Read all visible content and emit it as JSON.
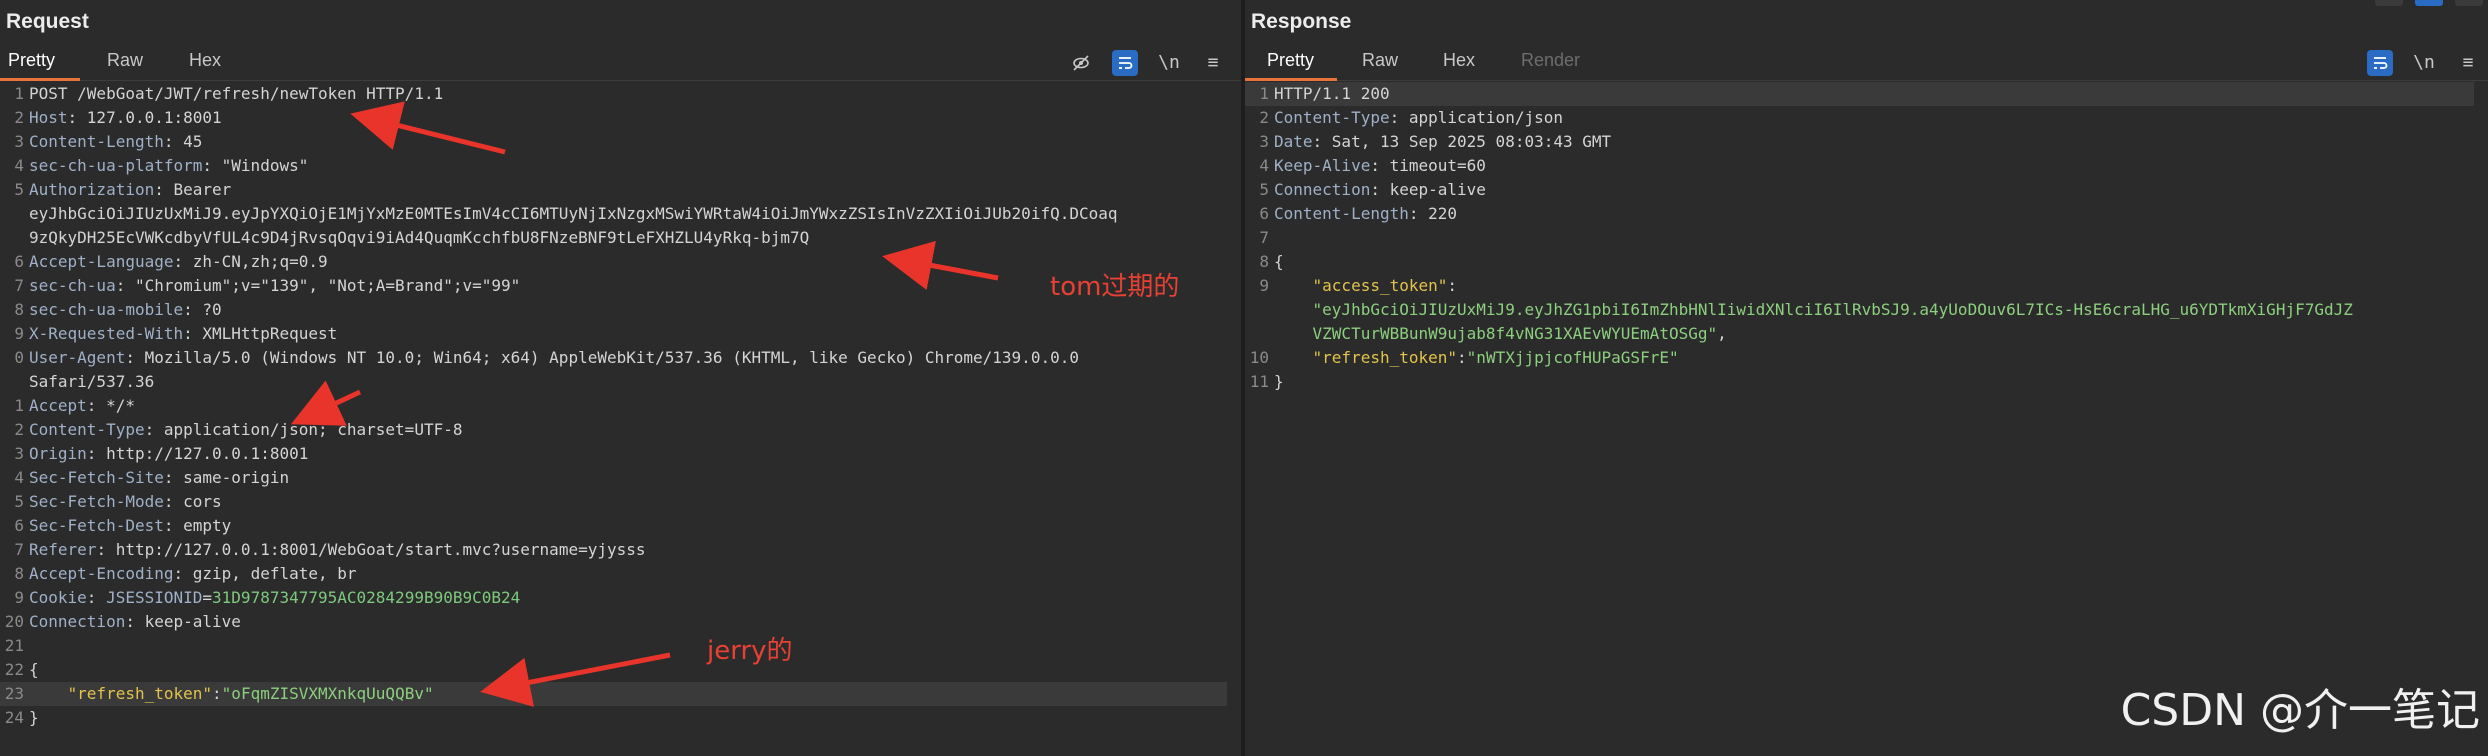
{
  "request": {
    "title": "Request",
    "tabs": [
      "Pretty",
      "Raw",
      "Hex"
    ],
    "toolbar": {
      "wrap_label": "\\n",
      "menu_label": "≡"
    },
    "lines": [
      {
        "no": "1",
        "parts": [
          {
            "t": "POST /WebGoat/JWT/refresh/newToken HTTP/1.1",
            "c": "v"
          }
        ]
      },
      {
        "no": "2",
        "parts": [
          {
            "t": "Host",
            "c": "k"
          },
          {
            "t": ": 127.0.0.1:8001",
            "c": "v"
          }
        ]
      },
      {
        "no": "3",
        "parts": [
          {
            "t": "Content-Length",
            "c": "k"
          },
          {
            "t": ": 45",
            "c": "v"
          }
        ]
      },
      {
        "no": "4",
        "parts": [
          {
            "t": "sec-ch-ua-platform",
            "c": "k"
          },
          {
            "t": ": \"Windows\"",
            "c": "v"
          }
        ]
      },
      {
        "no": "5",
        "parts": [
          {
            "t": "Authorization",
            "c": "k"
          },
          {
            "t": ": Bearer",
            "c": "v"
          }
        ]
      },
      {
        "no": "",
        "parts": [
          {
            "t": "eyJhbGciOiJIUzUxMiJ9.eyJpYXQiOjE1MjYxMzE0MTEsImV4cCI6MTUyNjIxNzgxMSwiYWRtaW4iOiJmYWxzZSIsInVzZXIiOiJUb20ifQ.DCoaq",
            "c": "v"
          }
        ]
      },
      {
        "no": "",
        "parts": [
          {
            "t": "9zQkyDH25EcVWKcdbyVfUL4c9D4jRvsqOqvi9iAd4QuqmKcchfbU8FNzeBNF9tLeFXHZLU4yRkq-bjm7Q",
            "c": "v"
          }
        ]
      },
      {
        "no": "6",
        "parts": [
          {
            "t": "Accept-Language",
            "c": "k"
          },
          {
            "t": ": zh-CN,zh;q=0.9",
            "c": "v"
          }
        ]
      },
      {
        "no": "7",
        "parts": [
          {
            "t": "sec-ch-ua",
            "c": "k"
          },
          {
            "t": ": \"Chromium\";v=\"139\", \"Not;A=Brand\";v=\"99\"",
            "c": "v"
          }
        ]
      },
      {
        "no": "8",
        "parts": [
          {
            "t": "sec-ch-ua-mobile",
            "c": "k"
          },
          {
            "t": ": ?0",
            "c": "v"
          }
        ]
      },
      {
        "no": "9",
        "parts": [
          {
            "t": "X-Requested-With",
            "c": "k"
          },
          {
            "t": ": XMLHttpRequest",
            "c": "v"
          }
        ]
      },
      {
        "no": "0",
        "parts": [
          {
            "t": "User-Agent",
            "c": "k"
          },
          {
            "t": ": Mozilla/5.0 (Windows NT 10.0; Win64; x64) AppleWebKit/537.36 (KHTML, like Gecko) Chrome/139.0.0.0",
            "c": "v"
          }
        ]
      },
      {
        "no": "",
        "parts": [
          {
            "t": "Safari/537.36",
            "c": "v"
          }
        ]
      },
      {
        "no": "1",
        "parts": [
          {
            "t": "Accept",
            "c": "k"
          },
          {
            "t": ": */*",
            "c": "v"
          }
        ]
      },
      {
        "no": "2",
        "parts": [
          {
            "t": "Content-Type",
            "c": "k"
          },
          {
            "t": ": application/json; charset=UTF-8",
            "c": "v"
          }
        ]
      },
      {
        "no": "3",
        "parts": [
          {
            "t": "Origin",
            "c": "k"
          },
          {
            "t": ": http://127.0.0.1:8001",
            "c": "v"
          }
        ]
      },
      {
        "no": "4",
        "parts": [
          {
            "t": "Sec-Fetch-Site",
            "c": "k"
          },
          {
            "t": ": same-origin",
            "c": "v"
          }
        ]
      },
      {
        "no": "5",
        "parts": [
          {
            "t": "Sec-Fetch-Mode",
            "c": "k"
          },
          {
            "t": ": cors",
            "c": "v"
          }
        ]
      },
      {
        "no": "6",
        "parts": [
          {
            "t": "Sec-Fetch-Dest",
            "c": "k"
          },
          {
            "t": ": empty",
            "c": "v"
          }
        ]
      },
      {
        "no": "7",
        "parts": [
          {
            "t": "Referer",
            "c": "k"
          },
          {
            "t": ": http://127.0.0.1:8001/WebGoat/start.mvc?username=yjysss",
            "c": "v"
          }
        ]
      },
      {
        "no": "8",
        "parts": [
          {
            "t": "Accept-Encoding",
            "c": "k"
          },
          {
            "t": ": gzip, deflate, br",
            "c": "v"
          }
        ]
      },
      {
        "no": "9",
        "parts": [
          {
            "t": "Cookie",
            "c": "k"
          },
          {
            "t": ": ",
            "c": "v"
          },
          {
            "t": "JSESSIONID",
            "c": "k"
          },
          {
            "t": "=",
            "c": "v"
          },
          {
            "t": "31D9787347795AC0284299B90B9C0B24",
            "c": "green"
          }
        ]
      },
      {
        "no": "20",
        "parts": [
          {
            "t": "Connection",
            "c": "k"
          },
          {
            "t": ": keep-alive",
            "c": "v"
          }
        ]
      },
      {
        "no": "21",
        "parts": []
      },
      {
        "no": "22",
        "parts": [
          {
            "t": "{",
            "c": "punct"
          }
        ]
      },
      {
        "no": "23",
        "highlight": true,
        "parts": [
          {
            "t": "    ",
            "c": "v"
          },
          {
            "t": "\"refresh_token\"",
            "c": "jsonkey"
          },
          {
            "t": ":",
            "c": "punct"
          },
          {
            "t": "\"oFqmZISVXMXnkqUuQQBv\"",
            "c": "jsonstr"
          }
        ]
      },
      {
        "no": "24",
        "parts": [
          {
            "t": "}",
            "c": "punct"
          }
        ]
      }
    ]
  },
  "response": {
    "title": "Response",
    "tabs": [
      "Pretty",
      "Raw",
      "Hex",
      "Render"
    ],
    "toolbar": {
      "wrap_label": "\\n",
      "menu_label": "≡"
    },
    "lines": [
      {
        "no": "1",
        "highlight": true,
        "parts": [
          {
            "t": "HTTP/1.1 200",
            "c": "v"
          }
        ]
      },
      {
        "no": "2",
        "parts": [
          {
            "t": "Content-Type",
            "c": "k"
          },
          {
            "t": ": application/json",
            "c": "v"
          }
        ]
      },
      {
        "no": "3",
        "parts": [
          {
            "t": "Date",
            "c": "k"
          },
          {
            "t": ": Sat, 13 Sep 2025 08:03:43 GMT",
            "c": "v"
          }
        ]
      },
      {
        "no": "4",
        "parts": [
          {
            "t": "Keep-Alive",
            "c": "k"
          },
          {
            "t": ": timeout=60",
            "c": "v"
          }
        ]
      },
      {
        "no": "5",
        "parts": [
          {
            "t": "Connection",
            "c": "k"
          },
          {
            "t": ": keep-alive",
            "c": "v"
          }
        ]
      },
      {
        "no": "6",
        "parts": [
          {
            "t": "Content-Length",
            "c": "k"
          },
          {
            "t": ": 220",
            "c": "v"
          }
        ]
      },
      {
        "no": "7",
        "parts": []
      },
      {
        "no": "8",
        "parts": [
          {
            "t": "{",
            "c": "punct"
          }
        ]
      },
      {
        "no": "9",
        "parts": [
          {
            "t": "    ",
            "c": "v"
          },
          {
            "t": "\"access_token\"",
            "c": "jsonkey"
          },
          {
            "t": ":",
            "c": "punct"
          }
        ]
      },
      {
        "no": "",
        "parts": [
          {
            "t": "    ",
            "c": "v"
          },
          {
            "t": "\"eyJhbGciOiJIUzUxMiJ9.eyJhZG1pbiI6ImZhbHNlIiwidXNlciI6IlRvbSJ9.a4yUoDOuv6L7ICs-HsE6craLHG_u6YDTkmXiGHjF7GdJZ",
            "c": "jsonstr"
          }
        ]
      },
      {
        "no": "",
        "parts": [
          {
            "t": "    ",
            "c": "v"
          },
          {
            "t": "VZWCTurWBBunW9ujab8f4vNG31XAEvWYUEmAtOSGg\"",
            "c": "jsonstr"
          },
          {
            "t": ",",
            "c": "punct"
          }
        ]
      },
      {
        "no": "10",
        "parts": [
          {
            "t": "    ",
            "c": "v"
          },
          {
            "t": "\"refresh_token\"",
            "c": "jsonkey"
          },
          {
            "t": ":",
            "c": "punct"
          },
          {
            "t": "\"nWTXjjpjcofHUPaGSFrE\"",
            "c": "jsonstr"
          }
        ]
      },
      {
        "no": "11",
        "parts": [
          {
            "t": "}",
            "c": "punct"
          }
        ]
      }
    ]
  },
  "annotations": {
    "expired_label": "tom过期的",
    "jerry_label": "jerry的"
  },
  "watermark": "CSDN @介一笔记",
  "colors": {
    "background": "#2b2b2b",
    "accent_tab": "#e8743b",
    "toggle_on": "#2a6cc4",
    "annotation": "#e84134",
    "json_key": "#e2c34b",
    "json_string": "#8ccf7e"
  },
  "icons": [
    "hide-icon",
    "wrap-toggle-icon",
    "newline-icon",
    "menu-icon"
  ]
}
